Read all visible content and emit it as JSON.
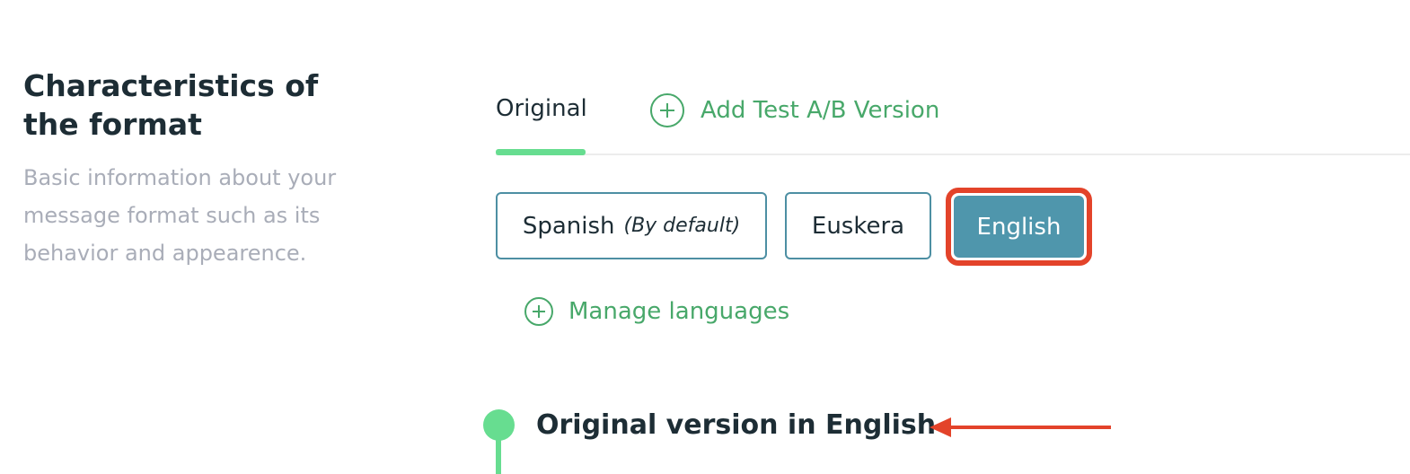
{
  "section": {
    "title": "Characteristics of the format",
    "description": "Basic information about your message format such as its behavior and appearence."
  },
  "tabs": {
    "original_label": "Original",
    "add_ab_label": "Add Test A/B Version",
    "add_icon": "plus-circle-icon"
  },
  "languages": {
    "spanish_label": "Spanish",
    "spanish_note": "(By default)",
    "euskera_label": "Euskera",
    "english_label": "English",
    "selected": "English"
  },
  "manage_languages_label": "Manage languages",
  "version": {
    "title": "Original version in English"
  },
  "colors": {
    "accent_green": "#67dd90",
    "link_green": "#48a86a",
    "selected_blue": "#4f96ac",
    "border_blue": "#4d8fa3",
    "highlight_red": "#e3432a",
    "text_dark": "#1d2d35",
    "text_muted": "#a9adb8"
  }
}
